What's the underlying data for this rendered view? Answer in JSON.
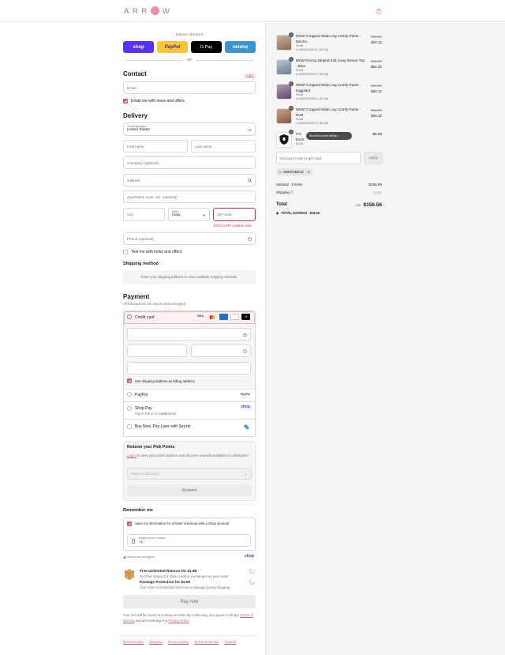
{
  "header": {
    "logo": "ARR W"
  },
  "express": {
    "label": "Express checkout",
    "shop": "shop",
    "paypal": "PayPal",
    "gpay": "G Pay",
    "venmo": "venmo",
    "or": "OR"
  },
  "contact": {
    "title": "Contact",
    "login": "Log in",
    "email_placeholder": "Email",
    "news_label": "Email me with news and offers"
  },
  "delivery": {
    "title": "Delivery",
    "country_label": "Country/Region",
    "country": "United States",
    "first": "First name",
    "last": "Last name",
    "company": "Company (optional)",
    "address": "Address",
    "apartment": "Apartment, suite, etc. (optional)",
    "city": "City",
    "state_label": "State",
    "state": "Iowa",
    "zip": "ZIP code",
    "zip_error": "Enter a ZIP / postal code",
    "phone": "Phone (optional)",
    "text_label": "Text me with news and offers"
  },
  "shipping": {
    "title": "Shipping method",
    "note": "Enter your shipping address to view available shipping methods."
  },
  "payment": {
    "title": "Payment",
    "subtitle": "All transactions are secure and encrypted.",
    "credit": "Credit card",
    "billing": "Use shipping address as billing address",
    "paypal": "PayPal",
    "shoppay": "Shop Pay",
    "shoppay_sub": "Pay in full or in installments",
    "sezzle": "Buy Now, Pay Later with Sezzle",
    "more": "+4",
    "shop_logo": "shop",
    "paypal_logo": "PayPal"
  },
  "rewards": {
    "title": "Redeem your Pink Points",
    "login": "Log in",
    "text": " to view your points balance and discover rewards available for redemption.",
    "select": "Select a discount",
    "redeem": "Redeem"
  },
  "remember": {
    "title": "Remember me",
    "save": "Save my information for a faster checkout with a Shop account",
    "mobile_label": "Mobile phone number",
    "mobile": "+1",
    "secure": "Secure and encrypted",
    "shop": "shop"
  },
  "addons": {
    "returns_title": "Free Unlimited Returns for $1.98",
    "returns_sub": "Get free returns for store credit or exchanges on your order",
    "prot_title": "Package Protection for $4.50",
    "prot_sub": "Your order is protected from loss or damage during shipping"
  },
  "pay": {
    "label": "Pay now",
    "legal1": "Your info will be saved to a Shop account. By continuing, you agree to Shop's ",
    "terms": "Terms of Service",
    "legal2": " and acknowledge the ",
    "privacy": "Privacy Policy",
    "legal3": "."
  },
  "footer": {
    "links": [
      "Refund policy",
      "Shipping",
      "Privacy policy",
      "Terms of service",
      "Contact"
    ]
  },
  "order": {
    "items": [
      {
        "qty": "1",
        "name": "NEW! Cropped Wide Leg Comfy Pants -",
        "name2": "Mocha",
        "variant": "Small",
        "discount": "AWESOME10 (-$3.68)",
        "was": "$36.80",
        "now": "$33.12"
      },
      {
        "qty": "1",
        "name": "NEW! Kenna Striped Knit Long Sleeve Top",
        "name2": "- Blue",
        "variant": "Small",
        "discount": "AWESOME10 (-$5.58)",
        "was": "$55.80",
        "now": "$50.22"
      },
      {
        "qty": "1",
        "name": "NEW! Cropped Wide Leg Comfy Pants -",
        "name2": "Eggplant",
        "variant": "Small",
        "discount": "AWESOME10 (-$3.68)",
        "was": "$36.80",
        "now": "$33.12"
      },
      {
        "qty": "1",
        "name": "NEW! Cropped Wide Leg Comfy Pants -",
        "name2": "Rust",
        "variant": "Small",
        "discount": "AWESOME10 (-$3.68)",
        "was": "$36.80",
        "now": "$33.12"
      }
    ],
    "item5": {
      "qty": "1",
      "name_a": "Fre",
      "name_b": "d or",
      "name2": "Exch",
      "sub": "$1.98",
      "now": "$6.98"
    },
    "scroll_hint": "Scroll for more items",
    "discount_placeholder": "Discount code or gift card",
    "apply": "Apply",
    "code": "AWESOME10",
    "subtotal_label": "Subtotal · 5 items",
    "subtotal": "$156.56",
    "shipping_label": "Shipping",
    "total_label": "Total",
    "currency": "USD",
    "total": "$156.56",
    "savings_label": "TOTAL SAVINGS",
    "savings": "$16.62"
  },
  "colors": {
    "accent": "#c95d7a",
    "shop": "#5a31f4",
    "paypal": "#ffc439",
    "venmo": "#3d95ce",
    "error": "#d92d4f"
  }
}
